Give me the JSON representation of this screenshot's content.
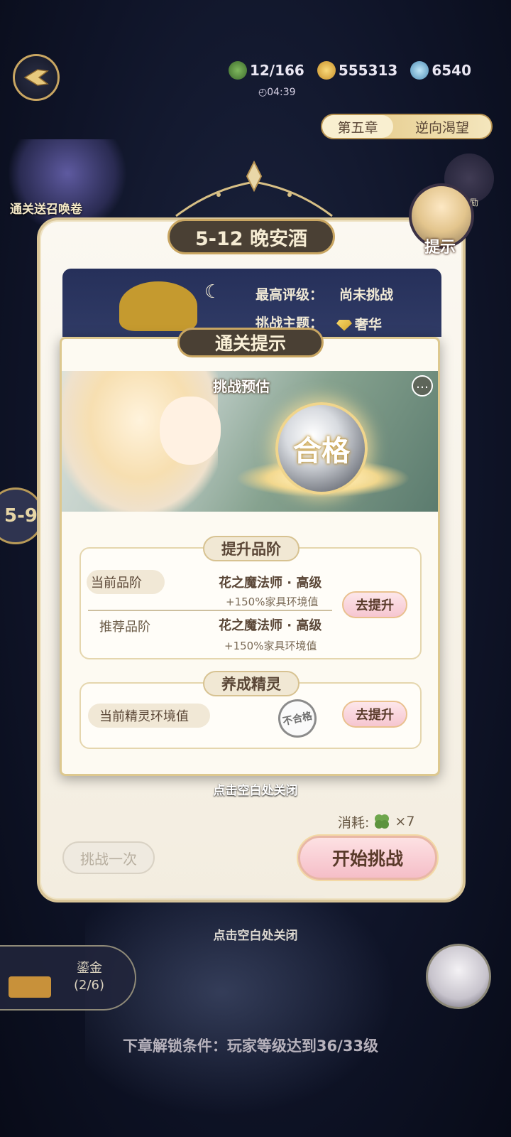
{
  "top_bar": {
    "stamina": "12/166",
    "coins": "555313",
    "gems": "6540",
    "timer": "◴04:39"
  },
  "chapter": {
    "number_label": "第五章",
    "name": "逆向渴望"
  },
  "promo": {
    "summon_text": "通关送召唤卷",
    "reward_text": "领奖励"
  },
  "hint": {
    "label": "提示"
  },
  "side_node": {
    "label": "5-9"
  },
  "level": {
    "title": "5-12 晚安酒",
    "best_rating_label": "最高评级：",
    "best_rating_value": "尚未挑战",
    "theme_label": "挑战主题：",
    "theme_value": "奢华"
  },
  "tips": {
    "title": "通关提示",
    "estimate_label": "挑战预估",
    "result": "合格",
    "more_icon": "…",
    "grade_section": {
      "heading": "提升品阶",
      "current_label": "当前品阶",
      "current_grade": "花之魔法师 · 高级",
      "current_bonus": "+150%家具环境值",
      "recommended_label": "推荐品阶",
      "recommended_grade": "花之魔法师 · 高级",
      "recommended_bonus": "+150%家具环境值",
      "button": "去提升"
    },
    "spirit_section": {
      "heading": "养成精灵",
      "label": "当前精灵环境值",
      "stamp": "不合格",
      "button": "去提升"
    },
    "close_hint": "点击空白处关闭"
  },
  "actions": {
    "consume_label": "消耗:",
    "consume_count": "×7",
    "try_once": "挑战一次",
    "start": "开始挑战",
    "close_hint": "点击空白处关闭"
  },
  "side_card": {
    "title": "鎏金",
    "progress": "(2/6)"
  },
  "footer": {
    "unlock_text": "下章解锁条件：玩家等级达到36/33级"
  },
  "colors": {
    "gold": "#c9a662",
    "dark_pill": "#4a4034",
    "panel_bg": "#fbf8f1",
    "pink_button": "#f6c6d0"
  }
}
